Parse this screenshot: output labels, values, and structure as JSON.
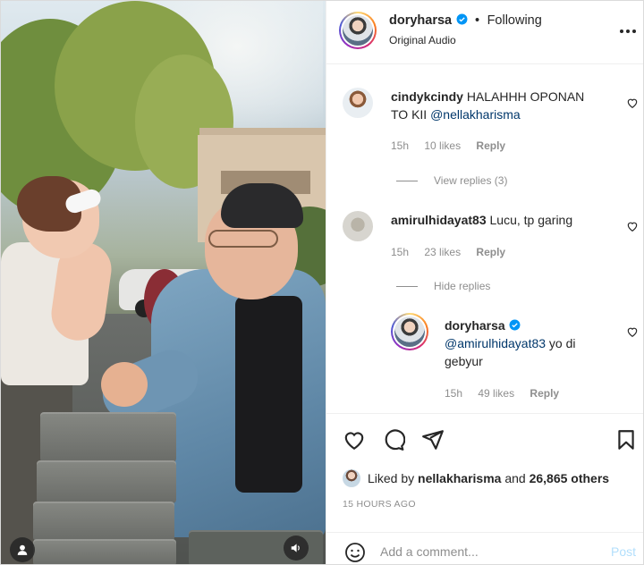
{
  "post": {
    "author": "doryharsa",
    "separator": "•",
    "follow_status": "Following",
    "audio": "Original Audio"
  },
  "comments": [
    {
      "username": "cindykcindy",
      "text": "HALAHHH OPONAN TO KII ",
      "mention": "@nellakharisma",
      "time": "15h",
      "likes": "10 likes",
      "reply": "Reply",
      "thread_toggle": "View replies (3)"
    },
    {
      "username": "amirulhidayat83",
      "text": "Lucu, tp garing",
      "time": "15h",
      "likes": "23 likes",
      "reply": "Reply",
      "thread_toggle": "Hide replies",
      "replies": [
        {
          "username": "doryharsa",
          "mention": "@amirulhidayat83",
          "text": " yo di gebyur",
          "time": "15h",
          "likes": "49 likes",
          "reply": "Reply"
        }
      ]
    }
  ],
  "likes": {
    "prefix": "Liked by ",
    "user": "nellakharisma",
    "middle": " and ",
    "others": "26,865 others"
  },
  "posted": "15 HOURS AGO",
  "add_comment": {
    "placeholder": "Add a comment...",
    "post_label": "Post"
  },
  "colors": {
    "link": "#00376b",
    "verified": "#0095f6",
    "muted": "#8e8e8e",
    "post_disabled": "#b2dffc"
  },
  "icons": {
    "verified": "verified-badge-icon",
    "more": "more-options-icon",
    "heart": "heart-icon",
    "comment": "comment-icon",
    "share": "share-icon",
    "save": "bookmark-icon",
    "emoji": "emoji-icon",
    "user_tag": "user-tag-icon",
    "sound": "sound-icon"
  }
}
